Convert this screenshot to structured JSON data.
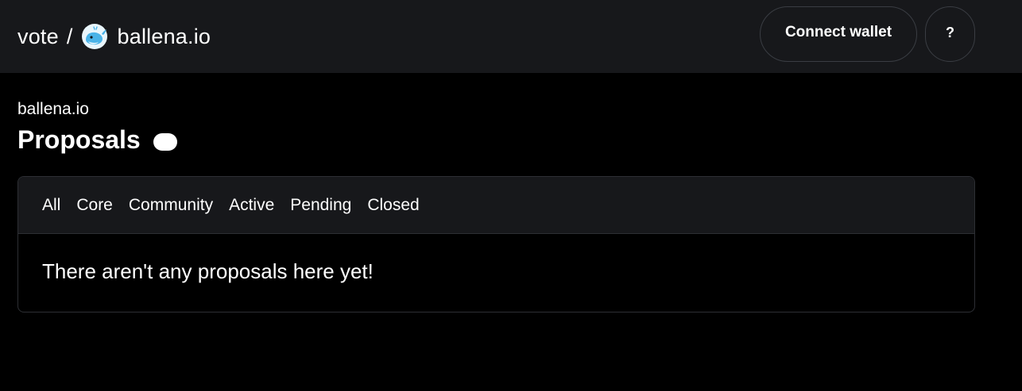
{
  "header": {
    "app_name": "vote",
    "separator": "/",
    "space_logo_icon": "whale-icon",
    "space_name": "ballena.io",
    "connect_label": "Connect wallet",
    "help_label": "?"
  },
  "main": {
    "space_name": "ballena.io",
    "title": "Proposals",
    "tabs": [
      {
        "label": "All"
      },
      {
        "label": "Core"
      },
      {
        "label": "Community"
      },
      {
        "label": "Active"
      },
      {
        "label": "Pending"
      },
      {
        "label": "Closed"
      }
    ],
    "empty_message": "There aren't any proposals here yet!"
  },
  "colors": {
    "background": "#000000",
    "header_bg": "#17181b",
    "border": "#2d2f34",
    "text": "#ffffff",
    "logo_blue": "#4ab3e8"
  }
}
